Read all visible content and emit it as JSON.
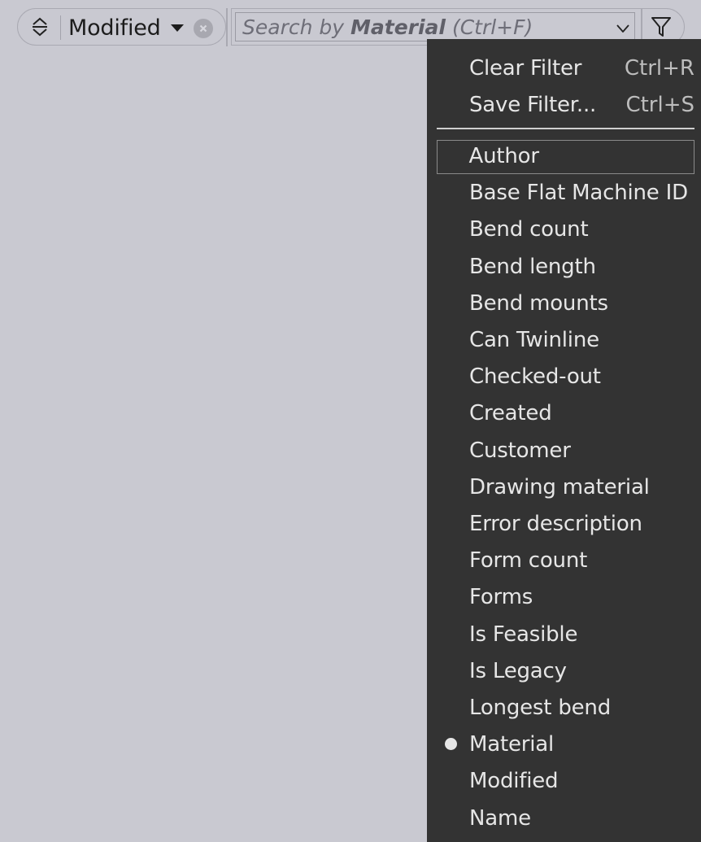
{
  "sort": {
    "field_label": "Modified",
    "toggle_icon": "sort-direction-icon",
    "clear_icon": "clear-circle-icon"
  },
  "search": {
    "placeholder_prefix": "Search by ",
    "placeholder_field": "Material",
    "placeholder_suffix": " (Ctrl+F)",
    "caret_icon": "chevron-down-icon",
    "filter_icon": "funnel-icon"
  },
  "menu": {
    "commands": [
      {
        "label": "Clear Filter",
        "shortcut": "Ctrl+R"
      },
      {
        "label": "Save Filter...",
        "shortcut": "Ctrl+S"
      }
    ],
    "fields": [
      {
        "label": "Author",
        "highlighted": true,
        "selected": false
      },
      {
        "label": "Base Flat Machine ID",
        "highlighted": false,
        "selected": false
      },
      {
        "label": "Bend count",
        "highlighted": false,
        "selected": false
      },
      {
        "label": "Bend length",
        "highlighted": false,
        "selected": false
      },
      {
        "label": "Bend mounts",
        "highlighted": false,
        "selected": false
      },
      {
        "label": "Can Twinline",
        "highlighted": false,
        "selected": false
      },
      {
        "label": "Checked-out",
        "highlighted": false,
        "selected": false
      },
      {
        "label": "Created",
        "highlighted": false,
        "selected": false
      },
      {
        "label": "Customer",
        "highlighted": false,
        "selected": false
      },
      {
        "label": "Drawing material",
        "highlighted": false,
        "selected": false
      },
      {
        "label": "Error description",
        "highlighted": false,
        "selected": false
      },
      {
        "label": "Form count",
        "highlighted": false,
        "selected": false
      },
      {
        "label": "Forms",
        "highlighted": false,
        "selected": false
      },
      {
        "label": "Is Feasible",
        "highlighted": false,
        "selected": false
      },
      {
        "label": "Is Legacy",
        "highlighted": false,
        "selected": false
      },
      {
        "label": "Longest bend",
        "highlighted": false,
        "selected": false
      },
      {
        "label": "Material",
        "highlighted": false,
        "selected": true
      },
      {
        "label": "Modified",
        "highlighted": false,
        "selected": false
      },
      {
        "label": "Name",
        "highlighted": false,
        "selected": false
      }
    ]
  },
  "colors": {
    "background": "#c9c9d1",
    "menu_background": "#333333",
    "menu_text": "#e6e6e6",
    "menu_highlight_border": "#8a8a8a"
  }
}
